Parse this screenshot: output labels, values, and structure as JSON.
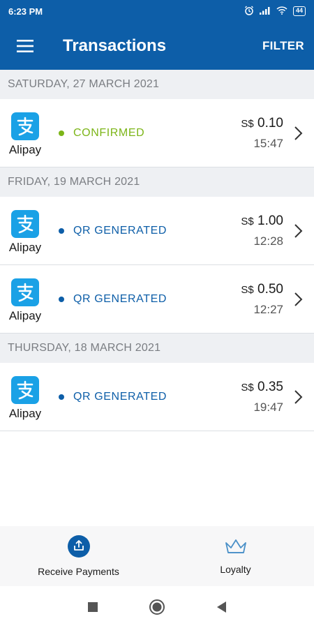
{
  "status_bar": {
    "time": "6:23 PM",
    "battery": "44"
  },
  "app_bar": {
    "title": "Transactions",
    "filter_label": "FILTER"
  },
  "colors": {
    "primary": "#0d5ea8",
    "confirmed": "#7cb518",
    "alipay": "#1aa1e6"
  },
  "groups": [
    {
      "date": "SATURDAY, 27 MARCH 2021",
      "transactions": [
        {
          "provider": "Alipay",
          "status": "CONFIRMED",
          "status_type": "confirmed",
          "currency": "S$",
          "amount": "0.10",
          "time": "15:47"
        }
      ]
    },
    {
      "date": "FRIDAY, 19 MARCH 2021",
      "transactions": [
        {
          "provider": "Alipay",
          "status": "QR GENERATED",
          "status_type": "generated",
          "currency": "S$",
          "amount": "1.00",
          "time": "12:28"
        },
        {
          "provider": "Alipay",
          "status": "QR GENERATED",
          "status_type": "generated",
          "currency": "S$",
          "amount": "0.50",
          "time": "12:27"
        }
      ]
    },
    {
      "date": "THURSDAY, 18 MARCH 2021",
      "transactions": [
        {
          "provider": "Alipay",
          "status": "QR GENERATED",
          "status_type": "generated",
          "currency": "S$",
          "amount": "0.35",
          "time": "19:47"
        }
      ]
    }
  ],
  "bottom_nav": [
    {
      "label": "Receive Payments",
      "icon": "receive-payments-icon"
    },
    {
      "label": "Loyalty",
      "icon": "crown-icon"
    }
  ]
}
